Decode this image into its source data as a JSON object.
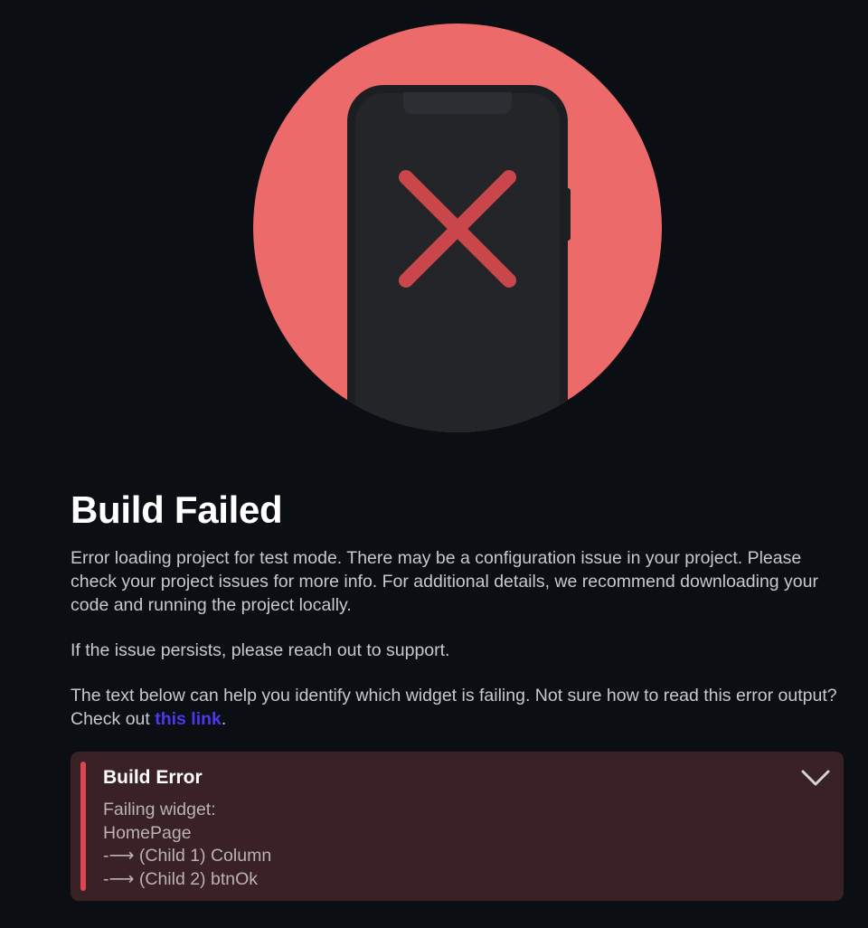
{
  "illustration": {
    "circle_color": "#ec6a6a",
    "phone_color": "#232528",
    "x_color": "#c9474a"
  },
  "heading": "Build Failed",
  "paragraphs": {
    "p1": "Error loading project for test mode. There may be a configuration issue in your project. Please check your project issues for more info. For additional details, we recommend downloading your code and running the project locally.",
    "p2": "If the issue persists, please reach out to support.",
    "p3_before": "The text below can help you identify which widget is failing. Not sure how to read this error output? Check out ",
    "p3_link": "this link",
    "p3_after": "."
  },
  "error_panel": {
    "title": "Build Error",
    "lines": [
      "Failing widget:",
      "HomePage",
      "-⟶ (Child 1) Column",
      "-⟶ (Child 2) btnOk"
    ],
    "toggle_icon": "chevron-down-icon"
  },
  "colors": {
    "background": "#0b0e13",
    "link": "#4b39ef",
    "error_bg": "#3a2125",
    "error_accent": "#e0464d"
  }
}
